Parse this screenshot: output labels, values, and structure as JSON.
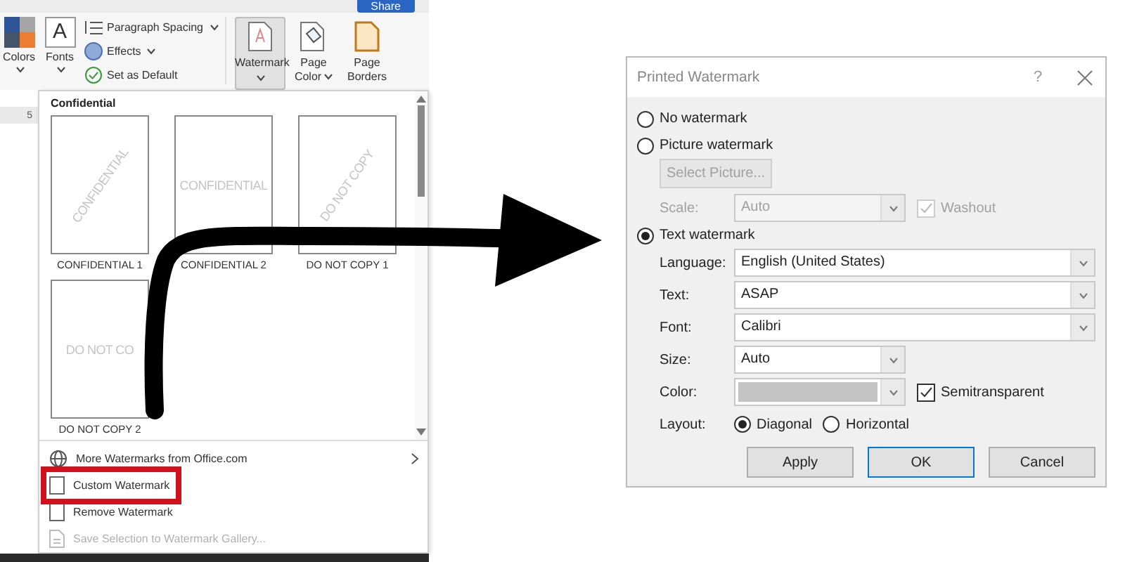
{
  "ribbon": {
    "share_button": "Share",
    "theme_buttons": [
      {
        "kind": "colors",
        "label": "Colors"
      },
      {
        "kind": "fonts",
        "label": "Fonts",
        "glyph": "A"
      }
    ],
    "paragraph_group": [
      {
        "kind": "spacing",
        "label": "Paragraph Spacing",
        "dropdown": true
      },
      {
        "kind": "effects",
        "label": "Effects",
        "dropdown": true
      },
      {
        "kind": "default",
        "label": "Set as Default",
        "dropdown": false
      }
    ],
    "page_buttons": [
      {
        "kind": "watermark",
        "label": "Watermark",
        "selected": true
      },
      {
        "kind": "page-color",
        "label": "Page Color",
        "selected": false
      },
      {
        "kind": "page-borders",
        "label": "Page Borders",
        "selected": false
      }
    ]
  },
  "ruler": {
    "mark": "5"
  },
  "gallery": {
    "heading": "Confidential",
    "items": [
      {
        "label": "CONFIDENTIAL 1",
        "watermark": "CONFIDENTIAL",
        "diagonal": true
      },
      {
        "label": "CONFIDENTIAL 2",
        "watermark": "CONFIDENTIAL",
        "diagonal": false
      },
      {
        "label": "DO NOT COPY 1",
        "watermark": "DO NOT COPY",
        "diagonal": true
      },
      {
        "label": "DO NOT COPY 2",
        "watermark": "DO NOT CO",
        "diagonal": false
      }
    ]
  },
  "menu": [
    {
      "kind": "globe",
      "label": "More Watermarks from Office.com",
      "submenu": true,
      "disabled": false,
      "marked": false
    },
    {
      "kind": "page",
      "label": "Custom Watermark",
      "submenu": false,
      "disabled": false,
      "marked": true
    },
    {
      "kind": "page",
      "label": "Remove Watermark",
      "submenu": false,
      "disabled": false,
      "marked": false
    },
    {
      "kind": "save",
      "label": "Save Selection to Watermark Gallery...",
      "submenu": false,
      "disabled": true,
      "marked": false
    }
  ],
  "dialog": {
    "title": "Printed Watermark",
    "help": "?",
    "options": [
      {
        "label": "No watermark",
        "selected": false
      },
      {
        "label": "Picture watermark",
        "selected": false
      },
      {
        "label": "Text watermark",
        "selected": true
      }
    ],
    "picture": {
      "button": "Select Picture...",
      "scale_label": "Scale:",
      "scale": "Auto",
      "washout": "Washout",
      "washout_checked": true,
      "disabled": true
    },
    "fields": [
      {
        "kind": "wide",
        "label": "Language:",
        "value": "English (United States)"
      },
      {
        "kind": "wide",
        "label": "Text:",
        "value": "ASAP"
      },
      {
        "kind": "wide",
        "label": "Font:",
        "value": "Calibri"
      },
      {
        "kind": "short",
        "label": "Size:",
        "value": "Auto"
      },
      {
        "kind": "color",
        "label": "Color:",
        "color": "#c4c4c4"
      }
    ],
    "semitransparent": {
      "label": "Semitransparent",
      "checked": true
    },
    "layout": {
      "label": "Layout:",
      "options": [
        {
          "label": "Diagonal",
          "selected": true
        },
        {
          "label": "Horizontal",
          "selected": false
        }
      ]
    },
    "buttons": [
      {
        "label": "Apply",
        "default": false
      },
      {
        "label": "OK",
        "default": true
      },
      {
        "label": "Cancel",
        "default": false
      }
    ]
  }
}
